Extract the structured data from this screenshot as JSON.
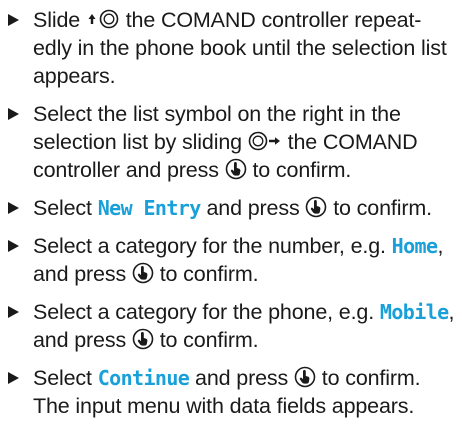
{
  "steps": [
    {
      "parts": [
        {
          "type": "text",
          "value": "Slide "
        },
        {
          "type": "icon",
          "name": "slide-up-icon"
        },
        {
          "type": "text",
          "value": " the COMAND controller repeat-edly in the phone book until the selection list appears."
        }
      ]
    },
    {
      "parts": [
        {
          "type": "text",
          "value": "Select the list symbol on the right in the selection list by sliding "
        },
        {
          "type": "icon",
          "name": "slide-right-icon"
        },
        {
          "type": "text",
          "value": " the COMAND controller and press "
        },
        {
          "type": "icon",
          "name": "press-controller-icon"
        },
        {
          "type": "text",
          "value": " to confirm."
        }
      ]
    },
    {
      "parts": [
        {
          "type": "text",
          "value": "Select "
        },
        {
          "type": "highlight",
          "value": "New Entry"
        },
        {
          "type": "text",
          "value": " and press "
        },
        {
          "type": "icon",
          "name": "press-controller-icon"
        },
        {
          "type": "text",
          "value": " to confirm."
        }
      ]
    },
    {
      "parts": [
        {
          "type": "text",
          "value": "Select a category for the number, e.g. "
        },
        {
          "type": "highlight",
          "value": "Home"
        },
        {
          "type": "text",
          "value": ", and press "
        },
        {
          "type": "icon",
          "name": "press-controller-icon"
        },
        {
          "type": "text",
          "value": " to confirm."
        }
      ]
    },
    {
      "parts": [
        {
          "type": "text",
          "value": "Select a category for the phone, e.g. "
        },
        {
          "type": "highlight",
          "value": "Mobile"
        },
        {
          "type": "text",
          "value": ", and press "
        },
        {
          "type": "icon",
          "name": "press-controller-icon"
        },
        {
          "type": "text",
          "value": " to confirm."
        }
      ]
    },
    {
      "parts": [
        {
          "type": "text",
          "value": "Select "
        },
        {
          "type": "highlight",
          "value": "Continue"
        },
        {
          "type": "text",
          "value": " and press "
        },
        {
          "type": "icon",
          "name": "press-controller-icon"
        },
        {
          "type": "text",
          "value": " to confirm. The input menu with data fields appears."
        }
      ]
    }
  ],
  "colors": {
    "text": "#1a1a1a",
    "highlight": "#1aa0d8"
  }
}
